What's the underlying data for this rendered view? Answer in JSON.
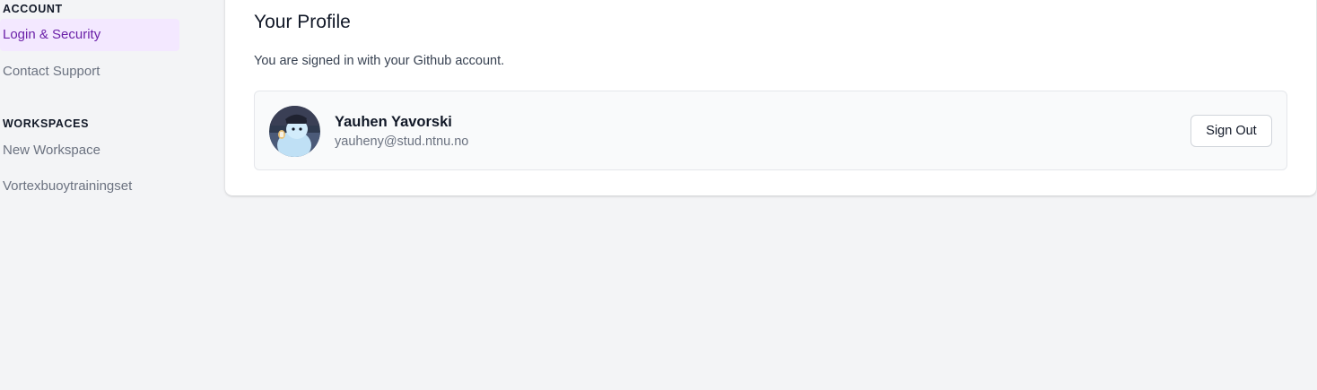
{
  "sidebar": {
    "account_title": "ACCOUNT",
    "account_items": [
      {
        "label": "Login & Security",
        "active": true
      },
      {
        "label": "Contact Support",
        "active": false
      }
    ],
    "workspaces_title": "WORKSPACES",
    "workspace_items": [
      {
        "label": "New Workspace"
      },
      {
        "label": "Vortexbuoytrainingset"
      }
    ]
  },
  "profile": {
    "title": "Your Profile",
    "subtitle": "You are signed in with your Github account.",
    "user": {
      "name": "Yauhen Yavorski",
      "email": "yauheny@stud.ntnu.no",
      "avatar_icon": "user-avatar-illustration"
    },
    "sign_out_label": "Sign Out"
  },
  "colors": {
    "page_background": "#f3f4f6",
    "active_nav_background": "#f3e8ff",
    "active_nav_text": "#6b21a8",
    "muted_text": "#6b7280"
  }
}
